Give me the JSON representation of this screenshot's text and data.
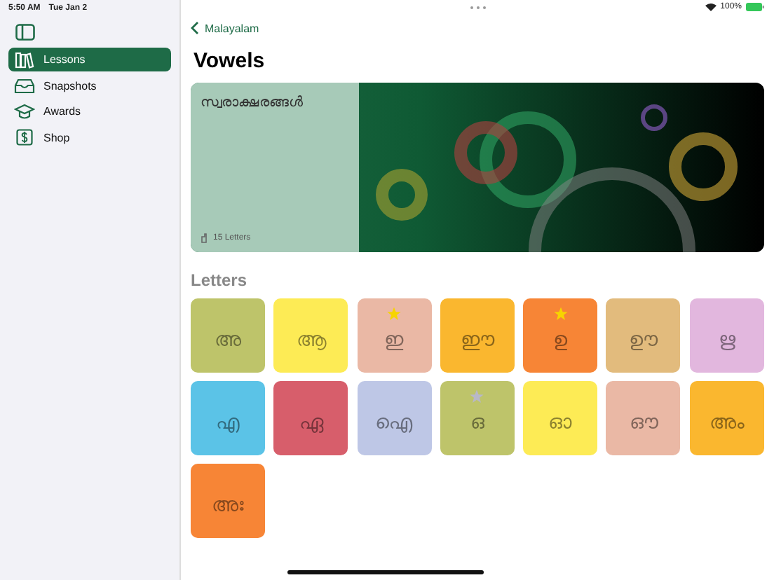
{
  "status_bar": {
    "time": "5:50 AM",
    "date": "Tue Jan 2",
    "battery": "100%"
  },
  "sidebar": {
    "items": [
      {
        "label": "Lessons",
        "selected": true
      },
      {
        "label": "Snapshots",
        "selected": false
      },
      {
        "label": "Awards",
        "selected": false
      },
      {
        "label": "Shop",
        "selected": false
      }
    ]
  },
  "nav": {
    "back": "Malayalam",
    "title": "Vowels"
  },
  "banner": {
    "title": "സ്വരാക്ഷരങ്ങൾ",
    "count": "15 Letters"
  },
  "letters_heading": "Letters",
  "letters": [
    {
      "glyph": "അ",
      "color": "#bec46a",
      "kind": "plain"
    },
    {
      "glyph": "ആ",
      "color": "#fdeb55",
      "kind": "plain"
    },
    {
      "glyph": "ഇ",
      "color": "#eab8a5",
      "kind": "gold"
    },
    {
      "glyph": "ഈ",
      "color": "#fab72f",
      "kind": "plain"
    },
    {
      "glyph": "ഉ",
      "color": "#f78536",
      "kind": "gold"
    },
    {
      "glyph": "ഊ",
      "color": "#e2bb7d",
      "kind": "plain"
    },
    {
      "glyph": "ഋ",
      "color": "#e2b7de",
      "kind": "plain"
    },
    {
      "glyph": "എ",
      "color": "#5bc3e7",
      "kind": "plain"
    },
    {
      "glyph": "ഏ",
      "color": "#d75e6b",
      "kind": "plain"
    },
    {
      "glyph": "ഐ",
      "color": "#bec7e6",
      "kind": "plain"
    },
    {
      "glyph": "ഒ",
      "color": "#bec46a",
      "kind": "silver"
    },
    {
      "glyph": "ഓ",
      "color": "#fdeb55",
      "kind": "plain"
    },
    {
      "glyph": "ഔ",
      "color": "#eab8a5",
      "kind": "plain"
    },
    {
      "glyph": "അം",
      "color": "#fab72f",
      "kind": "plain"
    },
    {
      "glyph": "അഃ",
      "color": "#f78536",
      "kind": "plain"
    }
  ]
}
